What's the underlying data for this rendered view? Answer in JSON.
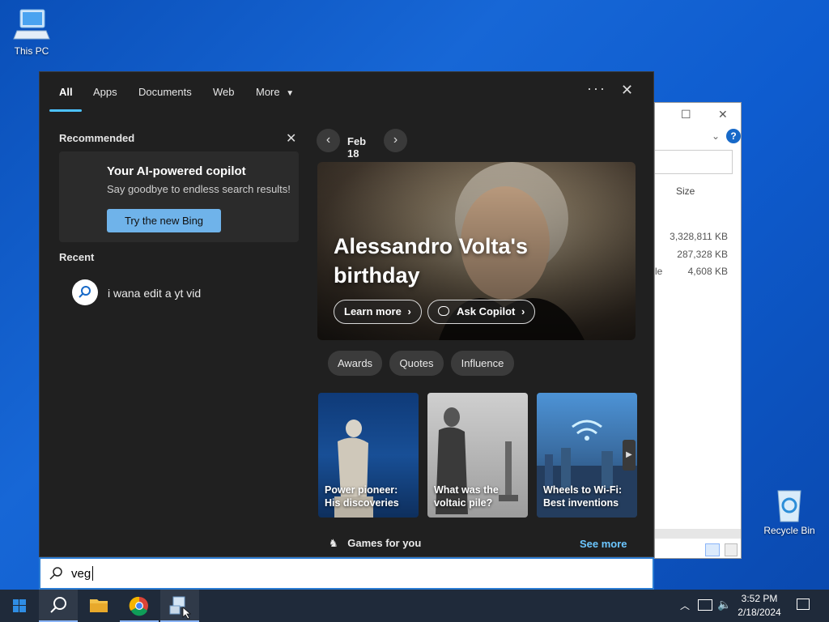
{
  "desktop": {
    "this_pc_label": "This PC",
    "recycle_bin_label": "Recycle Bin"
  },
  "explorer": {
    "column_size": "Size",
    "rows": [
      "3,328,811 KB",
      "287,328 KB",
      "4,608 KB"
    ],
    "partial_label": "le",
    "help_icon": "?"
  },
  "search_panel": {
    "tabs": [
      {
        "label": "All",
        "active": true
      },
      {
        "label": "Apps"
      },
      {
        "label": "Documents"
      },
      {
        "label": "Web"
      },
      {
        "label": "More"
      }
    ],
    "recommended_title": "Recommended",
    "recommended_card": {
      "title": "Your AI-powered copilot",
      "subtitle": "Say goodbye to endless search results!",
      "button": "Try the new Bing"
    },
    "recent_title": "Recent",
    "recent_items": [
      {
        "text": "i wana edit a yt vid"
      }
    ],
    "date": "Feb 18",
    "hero": {
      "title": "Alessandro Volta's birthday",
      "learn_more": "Learn more",
      "ask_copilot": "Ask Copilot"
    },
    "chips": [
      "Awards",
      "Quotes",
      "Influence"
    ],
    "cards": [
      {
        "text": "Power pioneer: His discoveries"
      },
      {
        "text": "What was the voltaic pile?"
      },
      {
        "text": "Wheels to Wi-Fi: Best inventions"
      }
    ],
    "games_label": "Games for you",
    "see_more": "See more"
  },
  "search_box": {
    "value": "veg"
  },
  "taskbar": {
    "time": "3:52 PM",
    "date": "2/18/2024"
  },
  "colors": {
    "accent": "#4cc2ff",
    "panel_bg": "#202020",
    "bing_button": "#6fb3ea",
    "link": "#6cc6ff"
  }
}
